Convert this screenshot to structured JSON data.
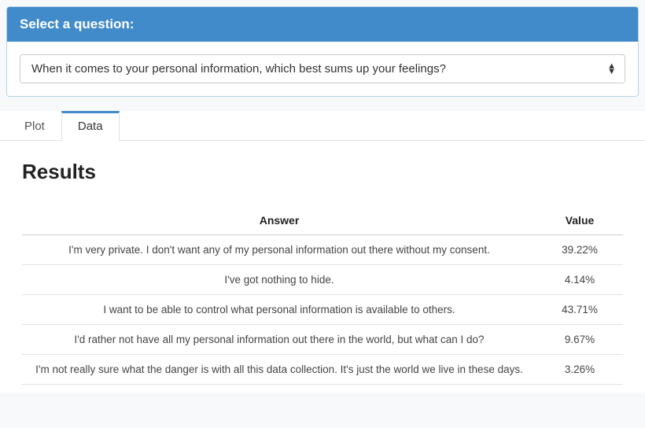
{
  "panel": {
    "title": "Select a question:",
    "selected_question": "When it comes to your personal information, which best sums up your feelings?"
  },
  "tabs": {
    "plot_label": "Plot",
    "data_label": "Data",
    "active": "data"
  },
  "results": {
    "heading": "Results",
    "columns": {
      "answer": "Answer",
      "value": "Value"
    },
    "rows": [
      {
        "answer": "I'm very private. I don't want any of my personal information out there without my consent.",
        "value": "39.22%"
      },
      {
        "answer": "I've got nothing to hide.",
        "value": "4.14%"
      },
      {
        "answer": "I want to be able to control what personal information is available to others.",
        "value": "43.71%"
      },
      {
        "answer": "I'd rather not have all my personal information out there in the world, but what can I do?",
        "value": "9.67%"
      },
      {
        "answer": "I'm not really sure what the danger is with all this data collection. It's just the world we live in these days.",
        "value": "3.26%"
      }
    ]
  },
  "chart_data": {
    "type": "table",
    "title": "Results",
    "columns": [
      "Answer",
      "Value"
    ],
    "rows": [
      [
        "I'm very private. I don't want any of my personal information out there without my consent.",
        39.22
      ],
      [
        "I've got nothing to hide.",
        4.14
      ],
      [
        "I want to be able to control what personal information is available to others.",
        43.71
      ],
      [
        "I'd rather not have all my personal information out there in the world, but what can I do?",
        9.67
      ],
      [
        "I'm not really sure what the danger is with all this data collection. It's just the world we live in these days.",
        3.26
      ]
    ]
  }
}
